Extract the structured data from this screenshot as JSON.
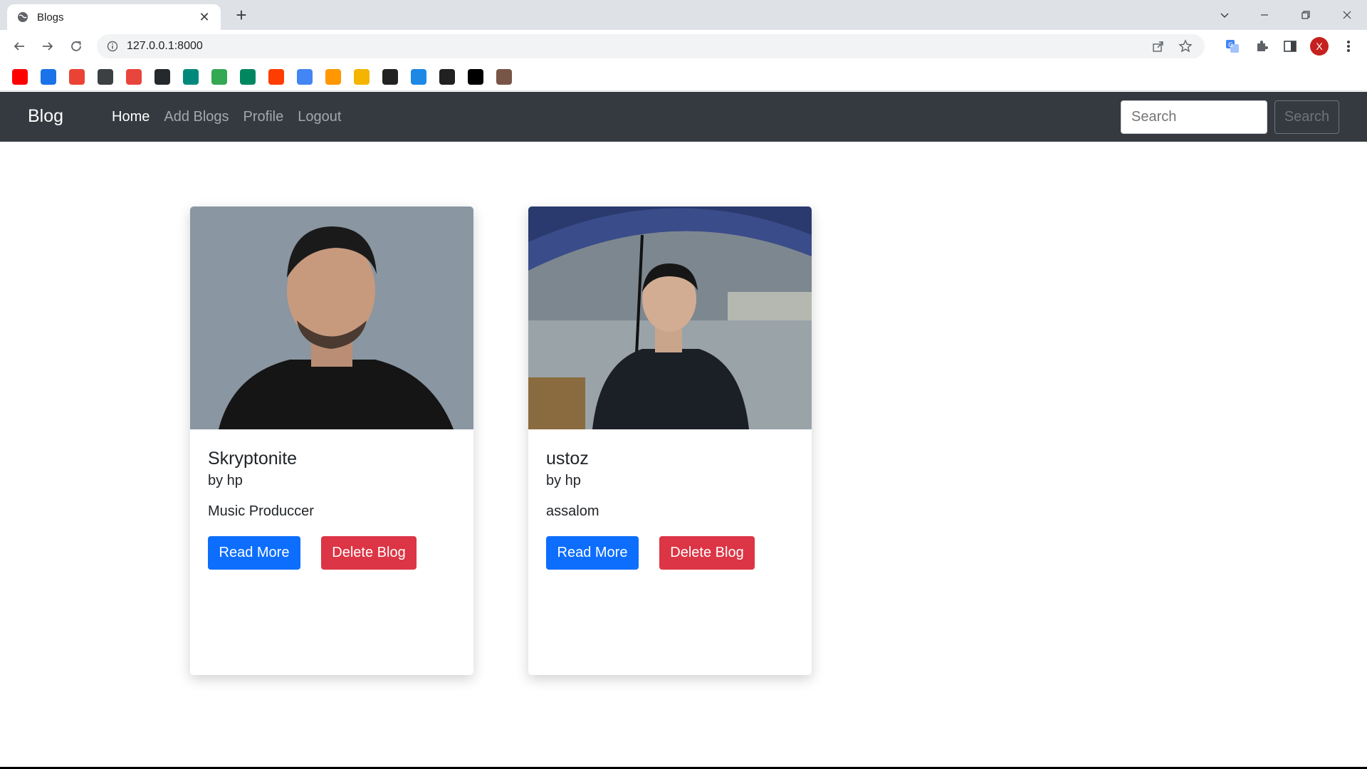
{
  "browser": {
    "tab_title": "Blogs",
    "url": "127.0.0.1:8000",
    "avatar_letter": "X",
    "bookmarks": [
      {
        "icon": "youtube-icon",
        "color": "#ff0000"
      },
      {
        "icon": "diamond-icon",
        "color": "#1a73e8"
      },
      {
        "icon": "gmail-icon",
        "color": "#ea4335"
      },
      {
        "icon": "globe-icon",
        "color": "#3c4043"
      },
      {
        "icon": "app-icon",
        "color": "#e8453c"
      },
      {
        "icon": "github-icon",
        "color": "#24292e"
      },
      {
        "icon": "meet-icon",
        "color": "#00897b"
      },
      {
        "icon": "play-circle-icon",
        "color": "#34a853"
      },
      {
        "icon": "play-store-icon",
        "color": "#01875f"
      },
      {
        "icon": "y-icon",
        "color": "#ff3d00"
      },
      {
        "icon": "translate-icon",
        "color": "#4285f4"
      },
      {
        "icon": "bolt-icon",
        "color": "#ff9800"
      },
      {
        "icon": "shapes-icon",
        "color": "#f4b400"
      },
      {
        "icon": "mt-icon",
        "color": "#222222"
      },
      {
        "icon": "check-icon",
        "color": "#1e88e5"
      },
      {
        "icon": "scissors-icon",
        "color": "#212121"
      },
      {
        "icon": "codepen-icon",
        "color": "#000000"
      },
      {
        "icon": "person-icon",
        "color": "#795548"
      }
    ]
  },
  "navbar": {
    "brand": "Blog",
    "links": [
      "Home",
      "Add Blogs",
      "Profile",
      "Logout"
    ],
    "active_link": "Home",
    "search_placeholder": "Search",
    "search_button": "Search"
  },
  "cards": [
    {
      "title": "Skryptonite",
      "author": "by hp",
      "description": "Music Produccer",
      "read_more": "Read More",
      "delete": "Delete Blog"
    },
    {
      "title": "ustoz",
      "author": "by hp",
      "description": "assalom",
      "read_more": "Read More",
      "delete": "Delete Blog"
    }
  ],
  "colors": {
    "navbar_bg": "#343a40",
    "primary": "#0d6efd",
    "danger": "#dc3545"
  }
}
